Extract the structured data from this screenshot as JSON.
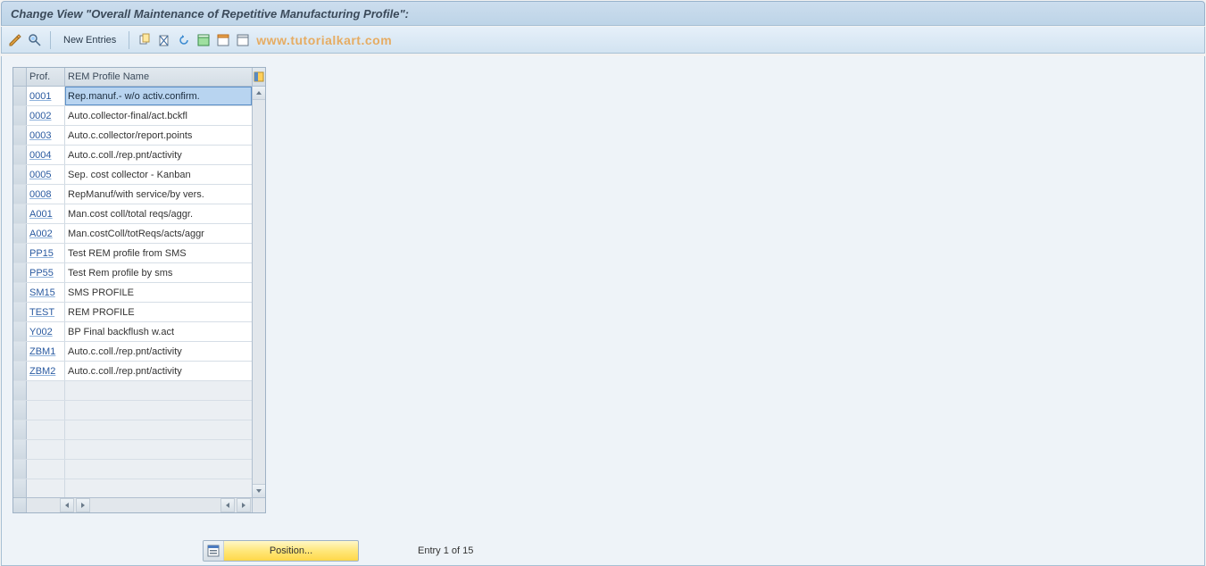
{
  "title": "Change View \"Overall Maintenance of Repetitive Manufacturing Profile\":",
  "toolbar": {
    "new_entries_label": "New Entries",
    "watermark": "www.tutorialkart.com"
  },
  "table": {
    "headers": {
      "prof": "Prof.",
      "name": "REM Profile Name"
    },
    "rows": [
      {
        "prof": "0001",
        "name": "Rep.manuf.- w/o activ.confirm.",
        "selected": true
      },
      {
        "prof": "0002",
        "name": "Auto.collector-final/act.bckfl"
      },
      {
        "prof": "0003",
        "name": "Auto.c.collector/report.points"
      },
      {
        "prof": "0004",
        "name": "Auto.c.coll./rep.pnt/activity"
      },
      {
        "prof": "0005",
        "name": "Sep. cost collector - Kanban"
      },
      {
        "prof": "0008",
        "name": "RepManuf/with service/by vers."
      },
      {
        "prof": "A001",
        "name": "Man.cost coll/total reqs/aggr."
      },
      {
        "prof": "A002",
        "name": "Man.costColl/totReqs/acts/aggr"
      },
      {
        "prof": "PP15",
        "name": "Test REM profile from SMS"
      },
      {
        "prof": "PP55",
        "name": "Test Rem profile by sms"
      },
      {
        "prof": "SM15",
        "name": "SMS PROFILE"
      },
      {
        "prof": "TEST",
        "name": "REM PROFILE"
      },
      {
        "prof": "Y002",
        "name": "BP Final backflush w.act"
      },
      {
        "prof": "ZBM1",
        "name": "Auto.c.coll./rep.pnt/activity"
      },
      {
        "prof": "ZBM2",
        "name": "Auto.c.coll./rep.pnt/activity"
      }
    ],
    "empty_rows": 6
  },
  "footer": {
    "position_label": "Position...",
    "entry_status": "Entry 1 of 15"
  }
}
